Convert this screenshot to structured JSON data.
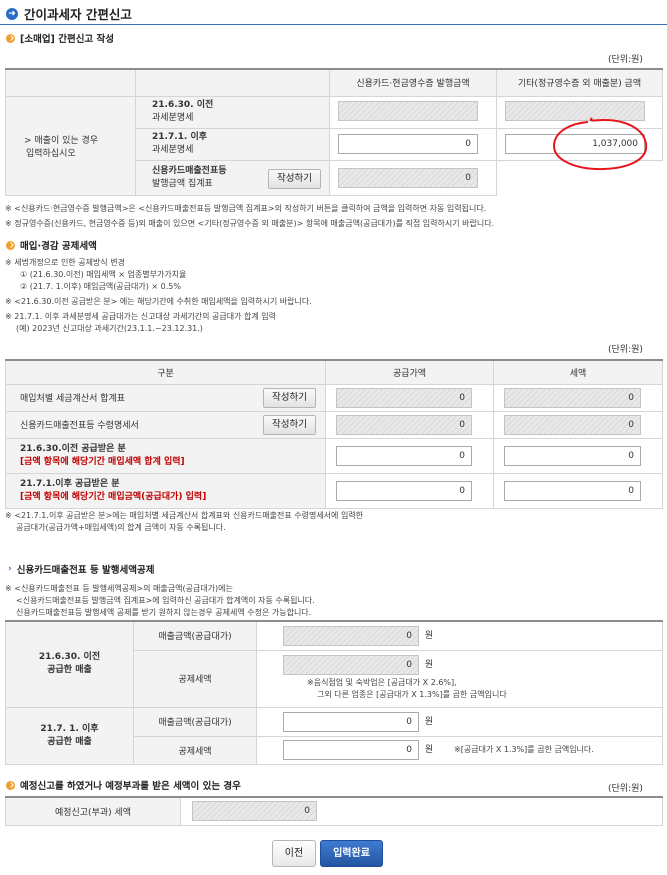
{
  "page_title": "간이과세자 간편신고",
  "section1": {
    "title": "[소매업] 간편신고 작성",
    "unit": "(단위:원)",
    "col_card": "신용카드·현금영수증 발행금액",
    "col_other": "기타(정규영수증 외 매출분) 금액",
    "side_label_1": "> 매출이 있는 경우",
    "side_label_2": "입력하십시오",
    "row1_label_1": "21.6.30. 이전",
    "row1_label_2": "과세분명세",
    "row2_label_1": "21.7.1. 이후",
    "row2_label_2": "과세분명세",
    "row2_card": "0",
    "row2_other": "1,037,000",
    "row3_label_1": "신용카드매출전표등",
    "row3_label_2": "발행금액 집계표",
    "row3_button": "작성하기",
    "row3_value": "0",
    "note1": "※ <신용카드·현금영수증 발행금액>은 <신용카드매출전표등 발행금액 집계표>의 작성하기 버튼을 클릭하여 금액을 입력하면 자동 입력됩니다.",
    "note2": "※ 정규영수증(신용카드, 현금영수증 등)외 매출이 있으면 <기타(정규영수증 외 매출분)> 항목에 매출금액(공급대가)를 직접 입력하시기 바랍니다."
  },
  "section2": {
    "title": "매입·경감 공제세액",
    "note_a": "※ 세법개정으로 인한 공제방식 변경",
    "note_a1": "① (21.6.30.이전) 매입세액 × 업종별부가가치율",
    "note_a2": "② (21.7. 1.이후) 매입금액(공급대가) × 0.5%",
    "note_b": "※ <21.6.30.이전 공급받은 분> 에는 해당기간에 수취한 매입세액을 입력하시기 바랍니다.",
    "note_c": "※ 21.7.1. 이후 과세분명세 공급대가는 신고대상 과세기간의 공급대가 합계 입력",
    "note_c1": "(예) 2023년 신고대상 과세기간(23.1.1.~23.12.31.)",
    "unit": "(단위:원)",
    "col_kind": "구분",
    "col_supply": "공급가액",
    "col_tax": "세액",
    "row1_label": "매입처별 세금계산서 합계표",
    "row1_button": "작성하기",
    "row1_supply": "0",
    "row1_tax": "0",
    "row2_label": "신용카드매출전표등 수령명세서",
    "row2_button": "작성하기",
    "row2_supply": "0",
    "row2_tax": "0",
    "row3_label": "21.6.30.이전 공급받은 분",
    "row3_sub": "[금액 항목에 해당기간 매입세액 합계 입력]",
    "row3_supply": "0",
    "row3_tax": "0",
    "row4_label": "21.7.1.이후 공급받은 분",
    "row4_sub": "[금액 항목에 해당기간 매입금액(공급대가) 입력]",
    "row4_supply": "0",
    "row4_tax": "0",
    "note_d": "※ <21.7.1.이후 공급받은 분>에는 매입처별 세금계산서 합계표와 신용카드매출전표 수령명세서에 입력한",
    "note_d2": "공급대가(공급가액+매입세액)의 합계 금액이 자동 수록됩니다."
  },
  "section3": {
    "title": "신용카드매출전표 등 발행세액공제",
    "note1": "※ <신용카드매출전표 등 발행세액공제>의 매출금액(공급대가)에는",
    "note2": "<신용카드매출전표등 발행금액 집계표>에 입력하신 공급대가 합계액이 자동 수록됩니다.",
    "note3": "신용카드매출전표등 발행세액 공제를 받기 원하지 않는경우 공제세액 수정은 가능합니다.",
    "groupA_1": "21.6.30. 이전",
    "groupA_2": "공급한 매출",
    "groupA_sales_label": "매출금액(공급대가)",
    "groupA_sales": "0",
    "groupA_won1": "원",
    "groupA_deduct_label": "공제세액",
    "groupA_deduct": "0",
    "groupA_won2": "원",
    "groupA_note1": "※음식점업 및 숙박업은 [공급대가 X 2.6%],",
    "groupA_note2": "그외 다른 업종은 [공급대가 X 1.3%]를 곱한 금액입니다",
    "groupB_1": "21.7. 1. 이후",
    "groupB_2": "공급한 매출",
    "groupB_sales_label": "매출금액(공급대가)",
    "groupB_sales": "0",
    "groupB_won1": "원",
    "groupB_deduct_label": "공제세액",
    "groupB_deduct": "0",
    "groupB_won2": "원",
    "groupB_note": "※[공급대가 X 1.3%]를 곱한 금액입니다."
  },
  "section4": {
    "title": "예정신고를 하였거나 예정부과를 받은 세액이 있는 경우",
    "unit": "(단위:원)",
    "label": "예정신고(부과) 세액",
    "value": "0"
  },
  "buttons": {
    "prev": "이전",
    "done": "입력완료"
  },
  "colors": {
    "accent_blue": "#2a6bc7",
    "orange": "#f0a030",
    "red_text": "#c00000",
    "annotation_red": "#e8141c"
  },
  "icons": {
    "title_icon": "arrow-circle-icon",
    "section_icon": "check-circle-icon"
  }
}
